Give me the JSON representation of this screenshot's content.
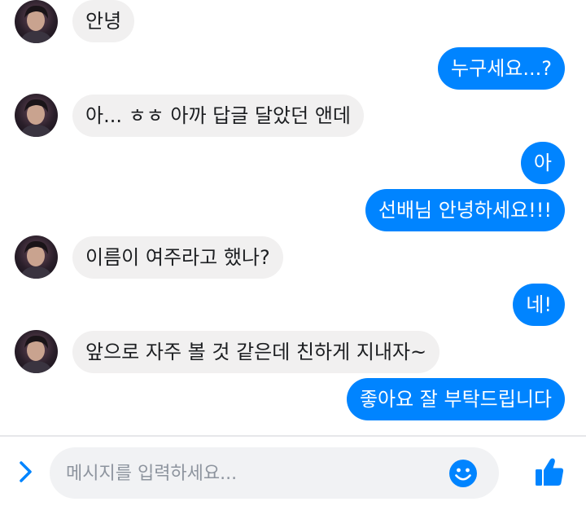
{
  "chat": {
    "messages": [
      {
        "direction": "in",
        "text": "안녕"
      },
      {
        "direction": "out",
        "text": "누구세요...?"
      },
      {
        "direction": "in",
        "text": "아... ㅎㅎ 아까 답글 달았던 앤데"
      },
      {
        "direction": "out",
        "text": "아"
      },
      {
        "direction": "out",
        "text": "선배님 안녕하세요!!!"
      },
      {
        "direction": "in",
        "text": "이름이 여주라고 했나?"
      },
      {
        "direction": "out",
        "text": "네!"
      },
      {
        "direction": "in",
        "text": "앞으로 자주 볼 것 같은데 친하게 지내자~"
      },
      {
        "direction": "out",
        "text": "좋아요 잘 부탁드립니다"
      }
    ]
  },
  "composer": {
    "placeholder": "메시지를 입력하세요...",
    "value": "",
    "icons": {
      "more": "chevron-right-icon",
      "emoji": "smiley-icon",
      "like": "thumbs-up-icon"
    }
  },
  "colors": {
    "accent": "#0084ff",
    "incoming_bubble": "#f1f0f0",
    "outgoing_text": "#ffffff",
    "incoming_text": "#1c1e21"
  }
}
